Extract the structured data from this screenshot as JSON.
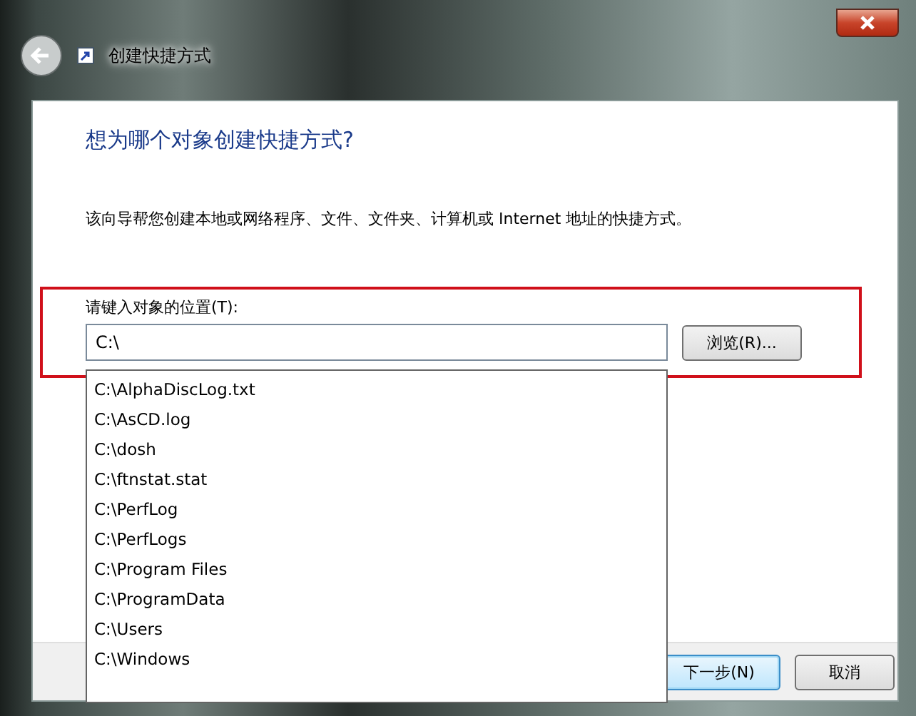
{
  "window": {
    "title": "创建快捷方式"
  },
  "heading": "想为哪个对象创建快捷方式?",
  "description": "该向导帮您创建本地或网络程序、文件、文件夹、计算机或 Internet 地址的快捷方式。",
  "location": {
    "label": "请键入对象的位置(T):",
    "value": "C:\\",
    "browse_button": "浏览(R)..."
  },
  "suggestions": [
    {
      "text": "C:\\AlphaDiscLog.txt",
      "selected": false
    },
    {
      "text": "C:\\AsCD.log",
      "selected": false
    },
    {
      "text": "C:\\dosh",
      "selected": false
    },
    {
      "text": "C:\\ftnstat.stat",
      "selected": false
    },
    {
      "text": "C:\\PerfLog",
      "selected": false
    },
    {
      "text": "C:\\PerfLogs",
      "selected": false
    },
    {
      "text": "C:\\Program Files",
      "selected": false
    },
    {
      "text": "C:\\ProgramData",
      "selected": false
    },
    {
      "text": "C:\\Users",
      "selected": false
    },
    {
      "text": "C:\\Windows",
      "selected": false
    }
  ],
  "buttons": [
    {
      "label": "下一步(N)",
      "kind": "default"
    },
    {
      "label": "取消",
      "kind": "normal"
    }
  ]
}
